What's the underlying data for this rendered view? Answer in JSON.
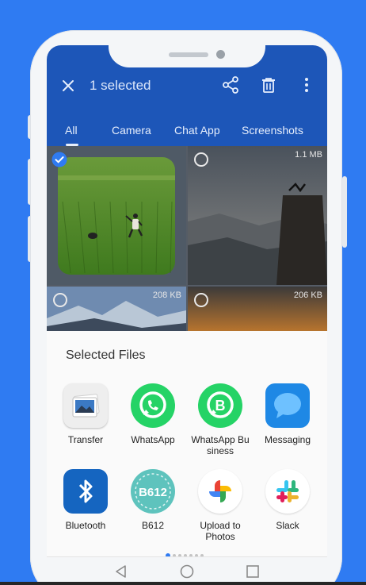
{
  "colors": {
    "background": "#2f7bf2",
    "appbar": "#1d56b8",
    "sheet": "#fafafa",
    "accent": "#2f7bf2"
  },
  "device": {
    "speaker": "speaker-grille",
    "camera": "front-camera"
  },
  "header": {
    "close_icon": "close-icon",
    "selection_label": "1 selected",
    "share_icon": "share-icon",
    "delete_icon": "delete-icon",
    "more_icon": "more-vert-icon"
  },
  "tabs": [
    {
      "label": "All",
      "active": true
    },
    {
      "label": "Camera",
      "active": false
    },
    {
      "label": "Chat App",
      "active": false
    },
    {
      "label": "Screenshots",
      "active": false
    }
  ],
  "gallery": {
    "items": [
      {
        "subject": "rice-field-photo",
        "size": "",
        "selected": true
      },
      {
        "subject": "cliff-sunset-photo",
        "size": "1.1 MB",
        "selected": false
      },
      {
        "subject": "snowy-mountain-photo",
        "size": "208 KB",
        "selected": false
      },
      {
        "subject": "sunset-photo",
        "size": "206 KB",
        "selected": false
      }
    ]
  },
  "share_sheet": {
    "title": "Selected Files",
    "apps": [
      {
        "label": "Transfer",
        "icon": "transfer-icon"
      },
      {
        "label": "WhatsApp",
        "icon": "whatsapp-icon"
      },
      {
        "label": "WhatsApp Bu siness",
        "icon": "whatsapp-business-icon"
      },
      {
        "label": "Messaging",
        "icon": "messaging-icon"
      },
      {
        "label": "Bluetooth",
        "icon": "bluetooth-icon"
      },
      {
        "label": "B612",
        "icon": "b612-icon",
        "icon_text": "B612"
      },
      {
        "label": "Upload to Photos",
        "icon": "google-photos-icon"
      },
      {
        "label": "Slack",
        "icon": "slack-icon"
      }
    ],
    "pages": {
      "current": 1,
      "total": 7
    }
  },
  "navbar": {
    "back_icon": "back-icon",
    "home_icon": "home-icon",
    "recents_icon": "recents-icon"
  }
}
